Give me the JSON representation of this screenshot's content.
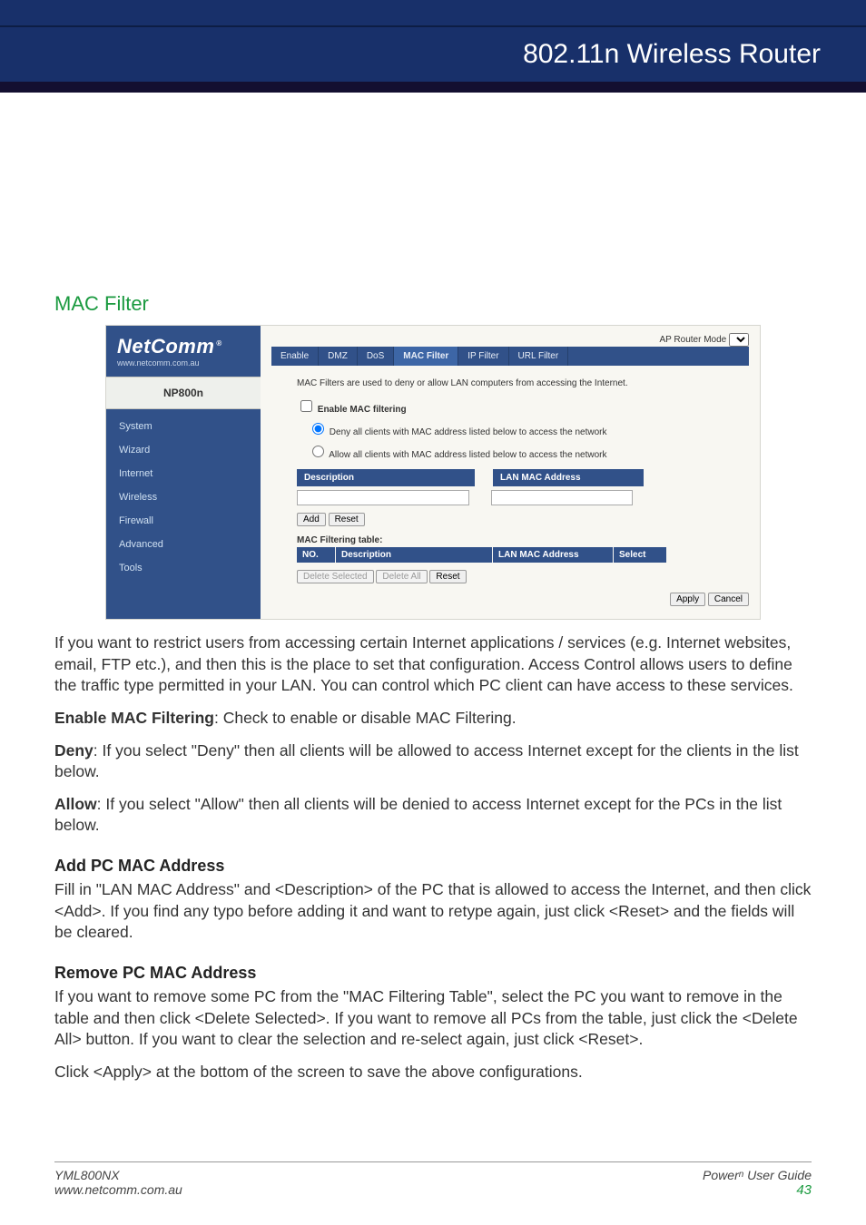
{
  "header": {
    "title": "802.11n Wireless Router"
  },
  "section": {
    "title": "MAC Filter"
  },
  "screenshot": {
    "logo": "NetComm",
    "logo_reg": "®",
    "logo_sub": "www.netcomm.com.au",
    "model": "NP800n",
    "mode_label": "AP Router Mode",
    "nav": [
      "System",
      "Wizard",
      "Internet",
      "Wireless",
      "Firewall",
      "Advanced",
      "Tools"
    ],
    "tabs": [
      "Enable",
      "DMZ",
      "DoS",
      "MAC Filter",
      "IP Filter",
      "URL Filter"
    ],
    "active_tab": "MAC Filter",
    "intro": "MAC Filters are used to deny or allow LAN computers from accessing the Internet.",
    "enable_label": "Enable MAC filtering",
    "radio_deny": "Deny all clients with MAC address listed below to access the network",
    "radio_allow": "Allow all clients with MAC address listed below to access the network",
    "col_desc": "Description",
    "col_mac": "LAN MAC Address",
    "btn_add": "Add",
    "btn_reset": "Reset",
    "tbl_title": "MAC Filtering table:",
    "tbl_no": "NO.",
    "tbl_desc": "Description",
    "tbl_mac": "LAN MAC Address",
    "tbl_sel": "Select",
    "btn_del_sel": "Delete Selected",
    "btn_del_all": "Delete All",
    "btn_reset2": "Reset",
    "btn_apply": "Apply",
    "btn_cancel": "Cancel"
  },
  "body": {
    "p1": "If you want to restrict users from accessing certain Internet applications / services (e.g. Internet websites, email, FTP etc.), and then this is the place to set that configuration. Access Control allows users to define the traffic type permitted in your LAN. You can control which PC client can have access to these services.",
    "enable_b": "Enable MAC Filtering",
    "enable_t": ": Check to enable or disable MAC Filtering.",
    "deny_b": "Deny",
    "deny_t": ": If you select \"Deny\" then all clients will be allowed to access Internet except for the clients in the list below.",
    "allow_b": "Allow",
    "allow_t": ": If you select \"Allow\" then all clients will be denied to access Internet except for the PCs in the list below.",
    "add_h": "Add PC MAC Address",
    "add_t": "Fill in \"LAN MAC Address\" and <Description> of the PC that is allowed to access the Internet, and then click <Add>. If you find any typo before adding it and want to retype again, just click <Reset> and the fields will be cleared.",
    "rem_h": "Remove PC MAC Address",
    "rem_t": "If you want to remove some PC from the \"MAC Filtering Table\", select the PC you want to remove in the table and then click <Delete Selected>. If you want to remove all PCs from the table, just click the <Delete All> button. If you want to clear the selection and re-select again, just click <Reset>.",
    "apply_t": "Click <Apply> at the bottom of the screen to save the above configurations."
  },
  "footer": {
    "model": "YML800NX",
    "url": "www.netcomm.com.au",
    "brand": "Power",
    "sup": "n",
    "guide": " User Guide",
    "page": "43"
  }
}
